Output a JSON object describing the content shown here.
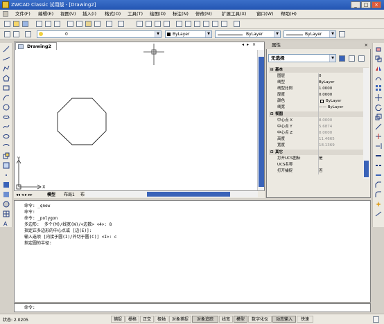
{
  "window": {
    "title": "ZWCAD Classic 试用版 - [Drawing2]",
    "minimize": "_",
    "maximize": "□",
    "close": "×"
  },
  "menubar": [
    "文件(F)",
    "编辑(E)",
    "视图(V)",
    "插入(I)",
    "格式(O)",
    "工具(T)",
    "绘图(D)",
    "标注(N)",
    "修改(M)",
    "扩展工具(X)",
    "窗口(W)",
    "帮助(H)"
  ],
  "toolbar": {
    "layer_value": "0",
    "color_value": "ByLayer",
    "linetype_value": "ByLayer",
    "lineweight_value": "ByLayer"
  },
  "drawing": {
    "tab_title": "Drawing2",
    "y_axis": "Y",
    "x_axis": "X"
  },
  "layout_tabs": [
    "模型",
    "布局1",
    "布局2"
  ],
  "properties": {
    "title": "属性",
    "selection": "无选择",
    "categories": {
      "basic": "基本",
      "view": "视图",
      "misc": "其它"
    },
    "basic_rows": [
      {
        "key": "图层",
        "value": "0"
      },
      {
        "key": "线型",
        "value": "ByLayer"
      },
      {
        "key": "线型比例",
        "value": "1.0000"
      },
      {
        "key": "厚度",
        "value": "0.0000"
      },
      {
        "key": "颜色",
        "value": "ByLayer"
      },
      {
        "key": "线宽",
        "value": "—— ByLayer"
      }
    ],
    "view_rows": [
      {
        "key": "中心点 X",
        "value": "8.0000"
      },
      {
        "key": "中心点 Y",
        "value": "5.6874"
      },
      {
        "key": "中心点 Z",
        "value": "0.0000"
      },
      {
        "key": "高度",
        "value": "11.4665"
      },
      {
        "key": "宽度",
        "value": "18.1369"
      }
    ],
    "misc_rows": [
      {
        "key": "打开UCS图标",
        "value": "是"
      },
      {
        "key": "UCS名称",
        "value": ""
      },
      {
        "key": "打开捕捉",
        "value": "否"
      }
    ]
  },
  "command_history": [
    "命令: _qnew",
    "命令:",
    "命令: _polygon",
    "多边形:  多个(M)/线宽(W)/<边数> <4>: 8",
    "指定正多边形的中心点或 [边(E)]:",
    "输入选项 [内接于圆(I)/外切于圆(C)] <I>: c",
    "指定圆的半径:"
  ],
  "command_prompt": "命令:",
  "status": {
    "coords": "状态: 2.0205",
    "buttons": [
      "捕捉",
      "栅格",
      "正交",
      "极轴",
      "对象捕捉",
      "对象追踪",
      "线宽",
      "模型",
      "数字化仪",
      "动态输入",
      "快速"
    ]
  },
  "colors": {
    "title_bar": "#2456b3",
    "accent": "#3a63b8",
    "chrome": "#ece9e1"
  }
}
